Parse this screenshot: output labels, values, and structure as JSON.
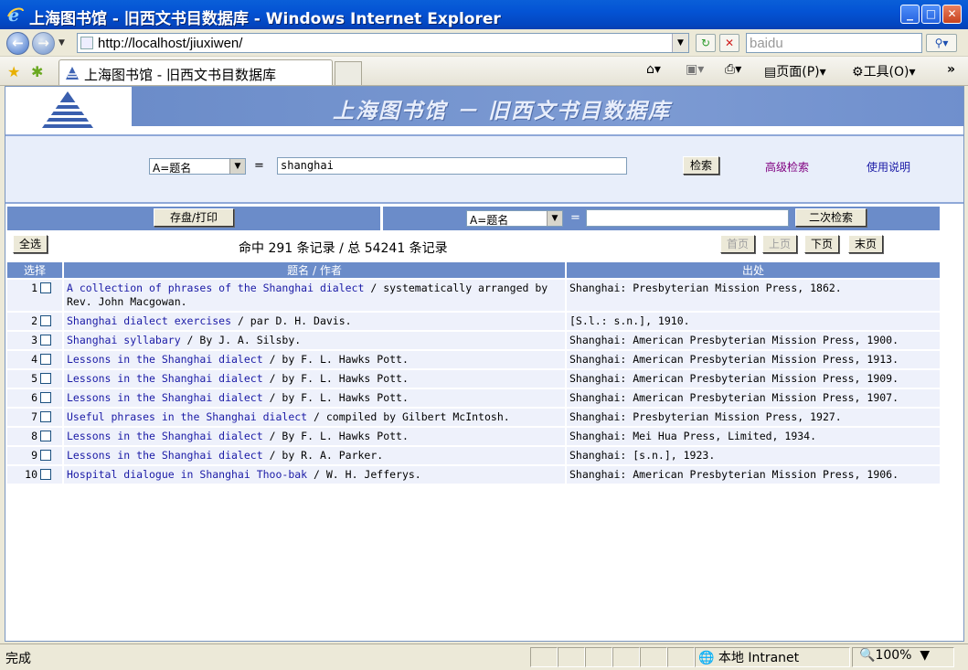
{
  "window": {
    "title": "上海图书馆 - 旧西文书目数据库 - Windows Internet Explorer",
    "minimize": "_",
    "maximize": "□",
    "close": "✕"
  },
  "address_bar": {
    "url": "http://localhost/jiuxiwen/",
    "search_value": "baidu"
  },
  "tab": {
    "label": "上海图书馆 - 旧西文书目数据库"
  },
  "command_bar": {
    "page": "页面(P)",
    "tools": "工具(O)"
  },
  "banner": {
    "title": "上海图书馆 － 旧西文书目数据库"
  },
  "search_form": {
    "field_select": "A=题名",
    "equals": "=",
    "query": "shanghai",
    "search_button": "检索",
    "advanced_link": "高级检索",
    "help_link": "使用说明"
  },
  "control_bar": {
    "save_print": "存盘/打印",
    "field_select": "A=题名",
    "equals": "=",
    "query": "",
    "secondary_search": "二次检索"
  },
  "results_info": {
    "select_all": "全选",
    "summary": "命中 291 条记录 / 总 54241 条记录",
    "first": "首页",
    "prev": "上页",
    "next": "下页",
    "last": "末页"
  },
  "table": {
    "headers": {
      "select": "选择",
      "title": "题名 / 作者",
      "publisher": "出处"
    },
    "rows": [
      {
        "num": "1",
        "title": "A collection of phrases of the Shanghai dialect",
        "author": " / systematically arranged by Rev. John Macgowan.",
        "publisher": "Shanghai: Presbyterian Mission Press, 1862."
      },
      {
        "num": "2",
        "title": "Shanghai dialect exercises",
        "author": " / par D. H. Davis.",
        "publisher": "[S.l.: s.n.], 1910."
      },
      {
        "num": "3",
        "title": "Shanghai syllabary",
        "author": " / By J. A. Silsby.",
        "publisher": "Shanghai: American Presbyterian Mission Press, 1900."
      },
      {
        "num": "4",
        "title": "Lessons in the Shanghai dialect",
        "author": " / by F. L. Hawks Pott.",
        "publisher": "Shanghai: American Presbyterian Mission Press, 1913."
      },
      {
        "num": "5",
        "title": "Lessons in the Shanghai dialect",
        "author": " / by F. L. Hawks Pott.",
        "publisher": "Shanghai: American Presbyterian Mission Press, 1909."
      },
      {
        "num": "6",
        "title": "Lessons in the Shanghai dialect",
        "author": " / by F. L. Hawks Pott.",
        "publisher": "Shanghai: American Presbyterian Mission Press, 1907."
      },
      {
        "num": "7",
        "title": "Useful phrases in the Shanghai dialect",
        "author": " / compiled by Gilbert McIntosh.",
        "publisher": "Shanghai: Presbyterian Mission Press, 1927."
      },
      {
        "num": "8",
        "title": "Lessons in the Shanghai dialect",
        "author": " / By F. L. Hawks Pott.",
        "publisher": "Shanghai: Mei Hua Press, Limited, 1934."
      },
      {
        "num": "9",
        "title": "Lessons in the Shanghai dialect",
        "author": " / by R. A. Parker.",
        "publisher": "Shanghai: [s.n.], 1923."
      },
      {
        "num": "10",
        "title": "Hospital dialogue in Shanghai Thoo-bak",
        "author": " / W. H. Jefferys.",
        "publisher": "Shanghai: American Presbyterian Mission Press, 1906."
      }
    ]
  },
  "status_bar": {
    "status": "完成",
    "zone": "本地 Intranet",
    "zoom": "100%"
  },
  "colors": {
    "banner_blue": "#6b8cc9",
    "panel_bg": "#e8eefa",
    "row_bg": "#eef1fb",
    "link": "#1a1aa6"
  }
}
